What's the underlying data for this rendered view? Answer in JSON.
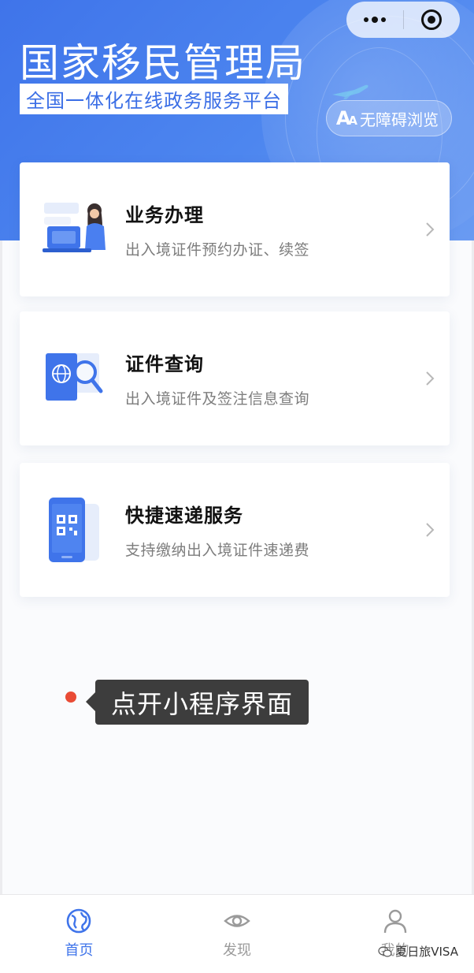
{
  "header": {
    "title": "国家移民管理局",
    "subtitle": "全国一体化在线政务服务平台",
    "accessibility_label": "无障碍浏览",
    "accessibility_icon_text": "A",
    "accessibility_icon_sub": "A"
  },
  "cards": [
    {
      "title": "业务办理",
      "desc": "出入境证件预约办证、续签",
      "icon": "person-laptop-icon"
    },
    {
      "title": "证件查询",
      "desc": "出入境证件及签注信息查询",
      "icon": "passport-search-icon"
    },
    {
      "title": "快捷速递服务",
      "desc": "支持缴纳出入境证件速递费",
      "icon": "phone-qr-icon"
    }
  ],
  "tooltip": {
    "text": "点开小程序界面"
  },
  "tabbar": {
    "items": [
      {
        "label": "首页",
        "icon": "globe-icon",
        "active": true
      },
      {
        "label": "发现",
        "icon": "eye-icon",
        "active": false
      },
      {
        "label": "我的",
        "icon": "user-icon",
        "active": false
      }
    ]
  },
  "watermark": {
    "text": "夏日旅VISA"
  },
  "colors": {
    "primary": "#3f74ea",
    "tooltip_bg": "#3d3d3d",
    "dot": "#e94b35"
  }
}
